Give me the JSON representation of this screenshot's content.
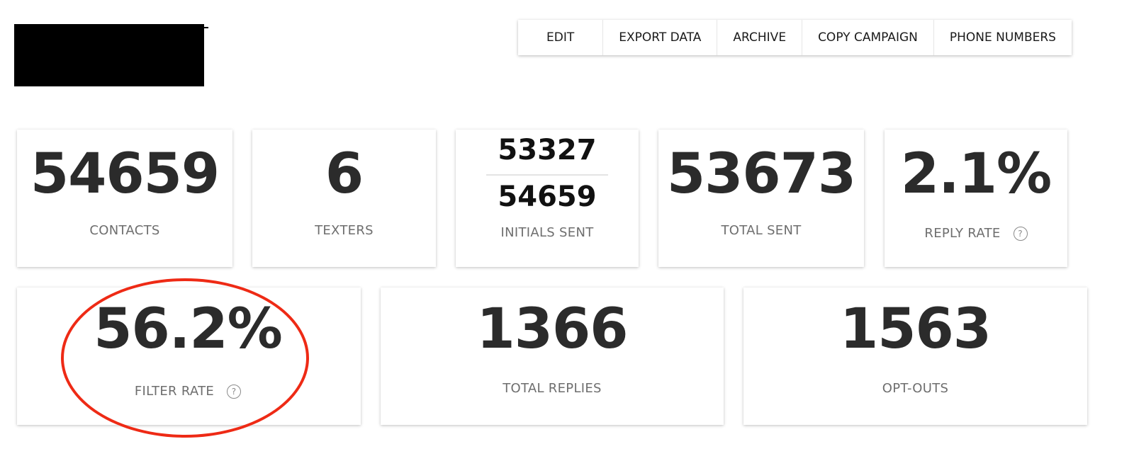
{
  "toolbar": {
    "edit_label": "EDIT",
    "export_label": "EXPORT DATA",
    "archive_label": "ARCHIVE",
    "copy_label": "COPY CAMPAIGN",
    "phone_numbers_label": "PHONE NUMBERS"
  },
  "stats": {
    "contacts": {
      "value": "54659",
      "label": "CONTACTS"
    },
    "texters": {
      "value": "6",
      "label": "TEXTERS"
    },
    "initials_sent": {
      "sent": "53327",
      "total": "54659",
      "label": "INITIALS SENT"
    },
    "total_sent": {
      "value": "53673",
      "label": "TOTAL SENT"
    },
    "reply_rate": {
      "value": "2.1%",
      "label": "REPLY RATE"
    },
    "filter_rate": {
      "value": "56.2%",
      "label": "FILTER RATE"
    },
    "total_replies": {
      "value": "1366",
      "label": "TOTAL REPLIES"
    },
    "opt_outs": {
      "value": "1563",
      "label": "OPT-OUTS"
    }
  },
  "icons": {
    "help": "?"
  },
  "colors": {
    "highlight": "#ee2a15",
    "value_text": "#2b2b2b",
    "label_text": "#6e6e6e"
  }
}
